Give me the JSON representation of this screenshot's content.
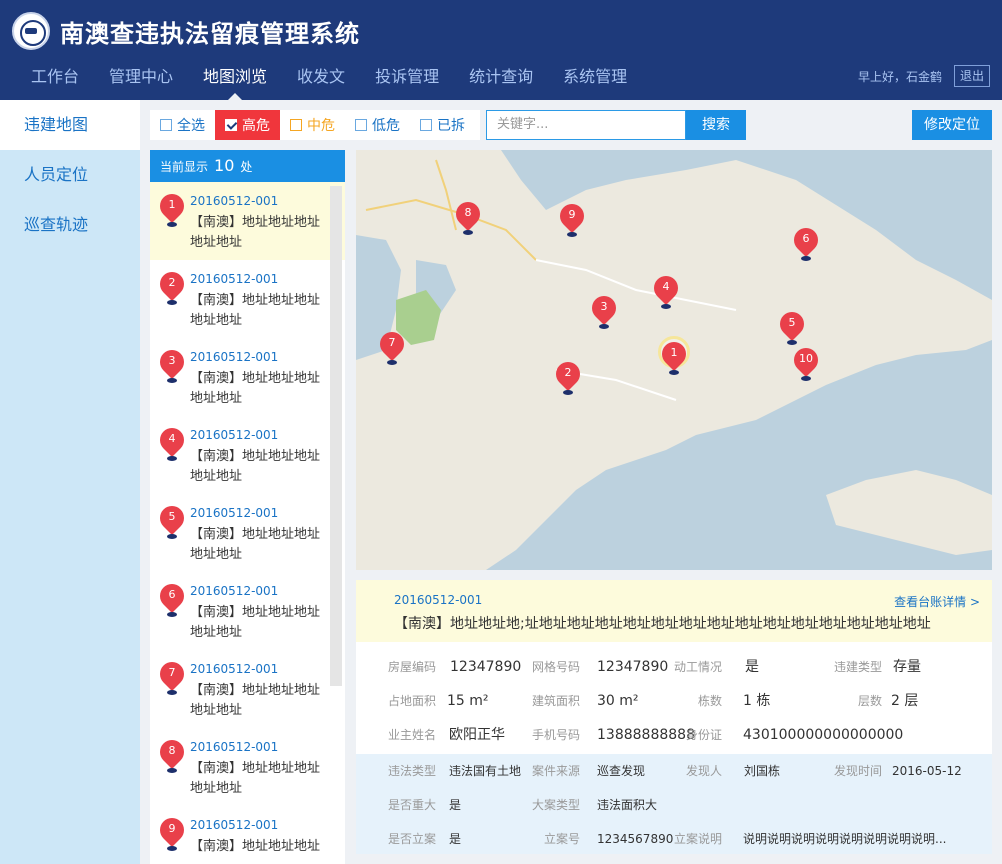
{
  "app": {
    "title": "南澳查违执法留痕管理系统",
    "greeting": "早上好，石金鹤",
    "logout": "退出"
  },
  "nav": [
    "工作台",
    "管理中心",
    "地图浏览",
    "收发文",
    "投诉管理",
    "统计查询",
    "系统管理"
  ],
  "nav_active": 2,
  "side": [
    "违建地图",
    "人员定位",
    "巡查轨迹"
  ],
  "filters": [
    "全选",
    "高危",
    "中危",
    "低危",
    "已拆"
  ],
  "search": {
    "placeholder": "关键字...",
    "button": "搜索"
  },
  "fix_button": "修改定位",
  "list": {
    "prefix": "当前显示",
    "count": "10",
    "suffix": "处",
    "items": [
      {
        "num": "1",
        "code": "20160512-001",
        "addr": "【南澳】地址地址地址地址地址"
      },
      {
        "num": "2",
        "code": "20160512-001",
        "addr": "【南澳】地址地址地址地址地址"
      },
      {
        "num": "3",
        "code": "20160512-001",
        "addr": "【南澳】地址地址地址地址地址"
      },
      {
        "num": "4",
        "code": "20160512-001",
        "addr": "【南澳】地址地址地址地址地址"
      },
      {
        "num": "5",
        "code": "20160512-001",
        "addr": "【南澳】地址地址地址地址地址"
      },
      {
        "num": "6",
        "code": "20160512-001",
        "addr": "【南澳】地址地址地址地址地址"
      },
      {
        "num": "7",
        "code": "20160512-001",
        "addr": "【南澳】地址地址地址地址地址"
      },
      {
        "num": "8",
        "code": "20160512-001",
        "addr": "【南澳】地址地址地址地址地址"
      },
      {
        "num": "9",
        "code": "20160512-001",
        "addr": "【南澳】地址地址地址"
      }
    ]
  },
  "map_markers": [
    "1",
    "2",
    "3",
    "4",
    "5",
    "6",
    "7",
    "8",
    "9",
    "10"
  ],
  "detail": {
    "code": "20160512-001",
    "link": "查看台账详情 >",
    "addr": "【南澳】地址地址地;址地址地址地址地址地址地址地址地址地址地址地址地址地址地址",
    "fields": {
      "house_code_label": "房屋编码",
      "house_code": "12347890",
      "grid_code_label": "网格号码",
      "grid_code": "12347890",
      "work_label": "动工情况",
      "work": "是",
      "type_label": "违建类型",
      "type": "存量",
      "land_area_label": "占地面积",
      "land_area": "15 m²",
      "build_area_label": "建筑面积",
      "build_area": "30 m²",
      "bldg_count_label": "栋数",
      "bldg_count": "1 栋",
      "floors_label": "层数",
      "floors": "2 层",
      "owner_label": "业主姓名",
      "owner": "欧阳正华",
      "phone_label": "手机号码",
      "phone": "13888888888",
      "id_label": "身份证",
      "id": "430100000000000000",
      "illegal_type_label": "违法类型",
      "illegal_type": "违法国有土地",
      "source_label": "案件来源",
      "source": "巡查发现",
      "finder_label": "发现人",
      "finder": "刘国栋",
      "found_time_label": "发现时间",
      "found_time": "2016-05-12",
      "major_label": "是否重大",
      "major": "是",
      "case_type_label": "大案类型",
      "case_type": "违法面积大",
      "filed_label": "是否立案",
      "filed": "是",
      "case_no_label": "立案号",
      "case_no": "1234567890",
      "note_label": "立案说明",
      "note": "说明说明说明说明说明说明说明说明..."
    }
  }
}
